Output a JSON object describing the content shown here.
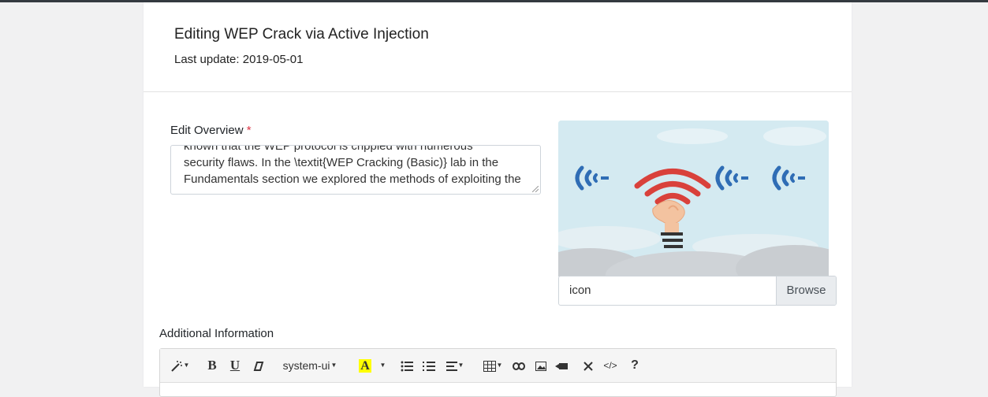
{
  "header": {
    "title": "Editing WEP Crack via Active Injection",
    "last_update": "Last update: 2019-05-01"
  },
  "overview": {
    "label": "Edit Overview",
    "required_mark": "*",
    "text": "known that the WEP protocol is crippled with numerous\nsecurity flaws. In the \\textit{WEP Cracking (Basic)} lab in the\nFundamentals section we explored the methods of exploiting the"
  },
  "image_upload": {
    "file_name": "icon",
    "browse_label": "Browse",
    "image_icon": "wifi-hand-illustration"
  },
  "additional": {
    "label": "Additional Information"
  },
  "toolbar": {
    "font_name": "system-ui",
    "highlight_letter": "A",
    "code_view": "</>",
    "help": "?",
    "icons": [
      "magic-wand-icon",
      "bold-icon",
      "underline-icon",
      "eraser-icon",
      "font-family-dropdown",
      "highlight-color-icon",
      "unordered-list-icon",
      "ordered-list-icon",
      "paragraph-align-icon",
      "table-icon",
      "link-icon",
      "picture-icon",
      "video-icon",
      "fullscreen-icon",
      "code-view-icon",
      "help-icon"
    ]
  },
  "colors": {
    "required": "#dc3545",
    "wifi_blue": "#2f6db5",
    "wifi_red": "#d9413b",
    "sky": "#d4eaf1",
    "highlight": "#ffff00"
  }
}
